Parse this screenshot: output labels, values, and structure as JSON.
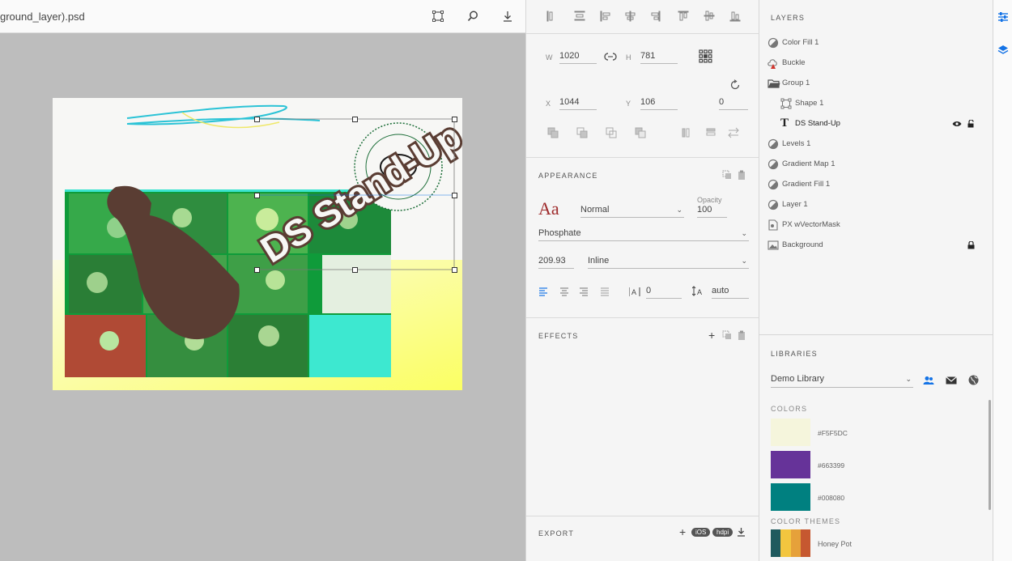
{
  "document": {
    "title": "ground_layer).psd",
    "toolbar": [
      "artboard-icon",
      "search-icon",
      "download-icon"
    ],
    "art_text": "DS Stand-Up"
  },
  "properties": {
    "align_icons": [
      "align-top-icon",
      "align-vcenter-icon",
      "align-left-icon",
      "align-hcenter-icon",
      "align-right-icon",
      "distribute-top-icon",
      "distribute-vcenter-icon",
      "distribute-bottom-icon"
    ],
    "w_label": "W",
    "w_value": "1020",
    "h_label": "H",
    "h_value": "781",
    "x_label": "X",
    "x_value": "1044",
    "y_label": "Y",
    "y_value": "106",
    "rotation_value": "0",
    "appearance_title": "APPEARANCE",
    "font_preview": "Aa",
    "blend_mode": "Normal",
    "opacity_label": "Opacity",
    "opacity_value": "100",
    "font_family": "Phosphate",
    "font_size": "209.93",
    "font_style": "Inline",
    "tracking_value": "0",
    "leading_value": "auto",
    "effects_title": "EFFECTS",
    "export_title": "EXPORT",
    "export_tag_ios": "iOS",
    "export_tag_hdpi": "hdpi"
  },
  "layers": {
    "title": "LAYERS",
    "items": [
      {
        "name": "Color Fill 1"
      },
      {
        "name": "Buckle"
      },
      {
        "name": "Group 1"
      },
      {
        "name": "Shape 1"
      },
      {
        "name": "DS Stand-Up"
      },
      {
        "name": "Levels 1"
      },
      {
        "name": "Gradient Map 1"
      },
      {
        "name": "Gradient Fill 1"
      },
      {
        "name": "Layer 1"
      },
      {
        "name": "PX wVectorMask"
      },
      {
        "name": "Background"
      }
    ]
  },
  "libraries": {
    "title": "LIBRARIES",
    "selected": "Demo Library",
    "colors_title": "COLORS",
    "colors": [
      {
        "hex": "#F5F5DC",
        "color": "#F5F5DC"
      },
      {
        "hex": "#663399",
        "color": "#663399"
      },
      {
        "hex": "#008080",
        "color": "#008080"
      }
    ],
    "themes_title": "COLOR THEMES",
    "theme_name": "Honey Pot",
    "theme_colors": [
      "#1f5a5e",
      "#f3c63f",
      "#e6a13a",
      "#c65830"
    ]
  },
  "colors": {
    "accent_red": "#9e2a2b",
    "bulb_brown": "#5a3d33",
    "selection_blue": "#1473e6"
  }
}
